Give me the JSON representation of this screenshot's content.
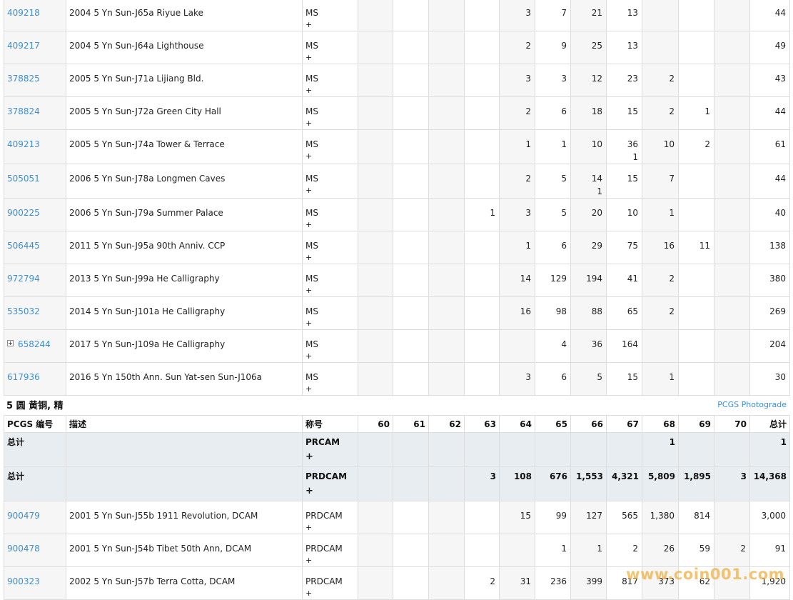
{
  "colors": {
    "link": "#3d8fd1",
    "total_row_bg": "#e8edf1",
    "alt_col_bg": "#f6f6f6",
    "watermark": "#f0b040"
  },
  "top_rows": [
    {
      "code": "409218",
      "expand": false,
      "desc": "2004 5 Yn Sun-J65a Riyue Lake",
      "desig": "MS",
      "desig_sub": "+",
      "g60": "",
      "g61": "",
      "g62": "",
      "g63": "",
      "g64": "3",
      "g65": "7",
      "g66": "21",
      "g67": "13",
      "g68": "",
      "g69": "",
      "g70": "",
      "total": "44",
      "plus": {}
    },
    {
      "code": "409217",
      "expand": false,
      "desc": "2004 5 Yn Sun-J64a Lighthouse",
      "desig": "MS",
      "desig_sub": "+",
      "g60": "",
      "g61": "",
      "g62": "",
      "g63": "",
      "g64": "2",
      "g65": "9",
      "g66": "25",
      "g67": "13",
      "g68": "",
      "g69": "",
      "g70": "",
      "total": "49",
      "plus": {}
    },
    {
      "code": "378825",
      "expand": false,
      "desc": "2005 5 Yn Sun-J71a Lijiang Bld.",
      "desig": "MS",
      "desig_sub": "+",
      "g60": "",
      "g61": "",
      "g62": "",
      "g63": "",
      "g64": "3",
      "g65": "3",
      "g66": "12",
      "g67": "23",
      "g68": "2",
      "g69": "",
      "g70": "",
      "total": "43",
      "plus": {}
    },
    {
      "code": "378824",
      "expand": false,
      "desc": "2005 5 Yn Sun-J72a Green City Hall",
      "desig": "MS",
      "desig_sub": "+",
      "g60": "",
      "g61": "",
      "g62": "",
      "g63": "",
      "g64": "2",
      "g65": "6",
      "g66": "18",
      "g67": "15",
      "g68": "2",
      "g69": "1",
      "g70": "",
      "total": "44",
      "plus": {}
    },
    {
      "code": "409213",
      "expand": false,
      "desc": "2005 5 Yn Sun-J74a Tower & Terrace",
      "desig": "MS",
      "desig_sub": "+",
      "g60": "",
      "g61": "",
      "g62": "",
      "g63": "",
      "g64": "1",
      "g65": "1",
      "g66": "10",
      "g67": "36",
      "g68": "10",
      "g69": "2",
      "g70": "",
      "total": "61",
      "plus": {
        "g67": "1"
      }
    },
    {
      "code": "505051",
      "expand": false,
      "desc": "2006 5 Yn Sun-J78a Longmen Caves",
      "desig": "MS",
      "desig_sub": "+",
      "g60": "",
      "g61": "",
      "g62": "",
      "g63": "",
      "g64": "2",
      "g65": "5",
      "g66": "14",
      "g67": "15",
      "g68": "7",
      "g69": "",
      "g70": "",
      "total": "44",
      "plus": {
        "g66": "1"
      }
    },
    {
      "code": "900225",
      "expand": false,
      "desc": "2006 5 Yn Sun-J79a Summer Palace",
      "desig": "MS",
      "desig_sub": "+",
      "g60": "",
      "g61": "",
      "g62": "",
      "g63": "1",
      "g64": "3",
      "g65": "5",
      "g66": "20",
      "g67": "10",
      "g68": "1",
      "g69": "",
      "g70": "",
      "total": "40",
      "plus": {}
    },
    {
      "code": "506445",
      "expand": false,
      "desc": "2011 5 Yn Sun-J95a 90th Anniv. CCP",
      "desig": "MS",
      "desig_sub": "+",
      "g60": "",
      "g61": "",
      "g62": "",
      "g63": "",
      "g64": "1",
      "g65": "6",
      "g66": "29",
      "g67": "75",
      "g68": "16",
      "g69": "11",
      "g70": "",
      "total": "138",
      "plus": {}
    },
    {
      "code": "972794",
      "expand": false,
      "desc": "2013 5 Yn Sun-J99a He Calligraphy",
      "desig": "MS",
      "desig_sub": "+",
      "g60": "",
      "g61": "",
      "g62": "",
      "g63": "",
      "g64": "14",
      "g65": "129",
      "g66": "194",
      "g67": "41",
      "g68": "2",
      "g69": "",
      "g70": "",
      "total": "380",
      "plus": {}
    },
    {
      "code": "535032",
      "expand": false,
      "desc": "2014 5 Yn Sun-J101a He Calligraphy",
      "desig": "MS",
      "desig_sub": "+",
      "g60": "",
      "g61": "",
      "g62": "",
      "g63": "",
      "g64": "16",
      "g65": "98",
      "g66": "88",
      "g67": "65",
      "g68": "2",
      "g69": "",
      "g70": "",
      "total": "269",
      "plus": {}
    },
    {
      "code": "658244",
      "expand": true,
      "desc": "2017 5 Yn Sun-J109a He Calligraphy",
      "desig": "MS",
      "desig_sub": "+",
      "g60": "",
      "g61": "",
      "g62": "",
      "g63": "",
      "g64": "",
      "g65": "4",
      "g66": "36",
      "g67": "164",
      "g68": "",
      "g69": "",
      "g70": "",
      "total": "204",
      "plus": {}
    },
    {
      "code": "617936",
      "expand": false,
      "desc": "2016 5 Yn 150th Ann. Sun Yat-sen Sun-J106a",
      "desig": "MS",
      "desig_sub": "+",
      "g60": "",
      "g61": "",
      "g62": "",
      "g63": "",
      "g64": "3",
      "g65": "6",
      "g66": "5",
      "g67": "15",
      "g68": "1",
      "g69": "",
      "g70": "",
      "total": "30",
      "plus": {}
    }
  ],
  "section": {
    "title": "5 圆 黄铜, 精",
    "photograde_link": "PCGS Photograde",
    "headers": [
      "PCGS 编号",
      "描述",
      "称号",
      "60",
      "61",
      "62",
      "63",
      "64",
      "65",
      "66",
      "67",
      "68",
      "69",
      "70",
      "总计"
    ],
    "totals": [
      {
        "label": "总计",
        "desig": "PRCAM",
        "desig_sub": "+",
        "g60": "",
        "g61": "",
        "g62": "",
        "g63": "",
        "g64": "",
        "g65": "",
        "g66": "",
        "g67": "",
        "g68": "1",
        "g69": "",
        "g70": "",
        "total": "1"
      },
      {
        "label": "总计",
        "desig": "PRDCAM",
        "desig_sub": "+",
        "g60": "",
        "g61": "",
        "g62": "",
        "g63": "3",
        "g64": "108",
        "g65": "676",
        "g66": "1,553",
        "g67": "4,321",
        "g68": "5,809",
        "g69": "1,895",
        "g70": "3",
        "total": "14,368"
      }
    ],
    "rows": [
      {
        "code": "900479",
        "expand": false,
        "desc": "2001 5 Yn Sun-J55b 1911 Revolution, DCAM",
        "desig": "PRDCAM",
        "desig_sub": "+",
        "g60": "",
        "g61": "",
        "g62": "",
        "g63": "",
        "g64": "15",
        "g65": "99",
        "g66": "127",
        "g67": "565",
        "g68": "1,380",
        "g69": "814",
        "g70": "",
        "total": "3,000",
        "plus": {}
      },
      {
        "code": "900478",
        "expand": false,
        "desc": "2001 5 Yn Sun-J54b Tibet 50th Ann, DCAM",
        "desig": "PRDCAM",
        "desig_sub": "+",
        "g60": "",
        "g61": "",
        "g62": "",
        "g63": "",
        "g64": "",
        "g65": "1",
        "g66": "1",
        "g67": "2",
        "g68": "26",
        "g69": "59",
        "g70": "2",
        "total": "91",
        "plus": {}
      },
      {
        "code": "900323",
        "expand": false,
        "desc": "2002 5 Yn Sun-J57b Terra Cotta, DCAM",
        "desig": "PRDCAM",
        "desig_sub": "+",
        "g60": "",
        "g61": "",
        "g62": "",
        "g63": "2",
        "g64": "31",
        "g65": "236",
        "g66": "399",
        "g67": "817",
        "g68": "373",
        "g69": "62",
        "g70": "",
        "total": "1,920",
        "plus": {}
      }
    ]
  },
  "watermark": "www.coin001.com"
}
